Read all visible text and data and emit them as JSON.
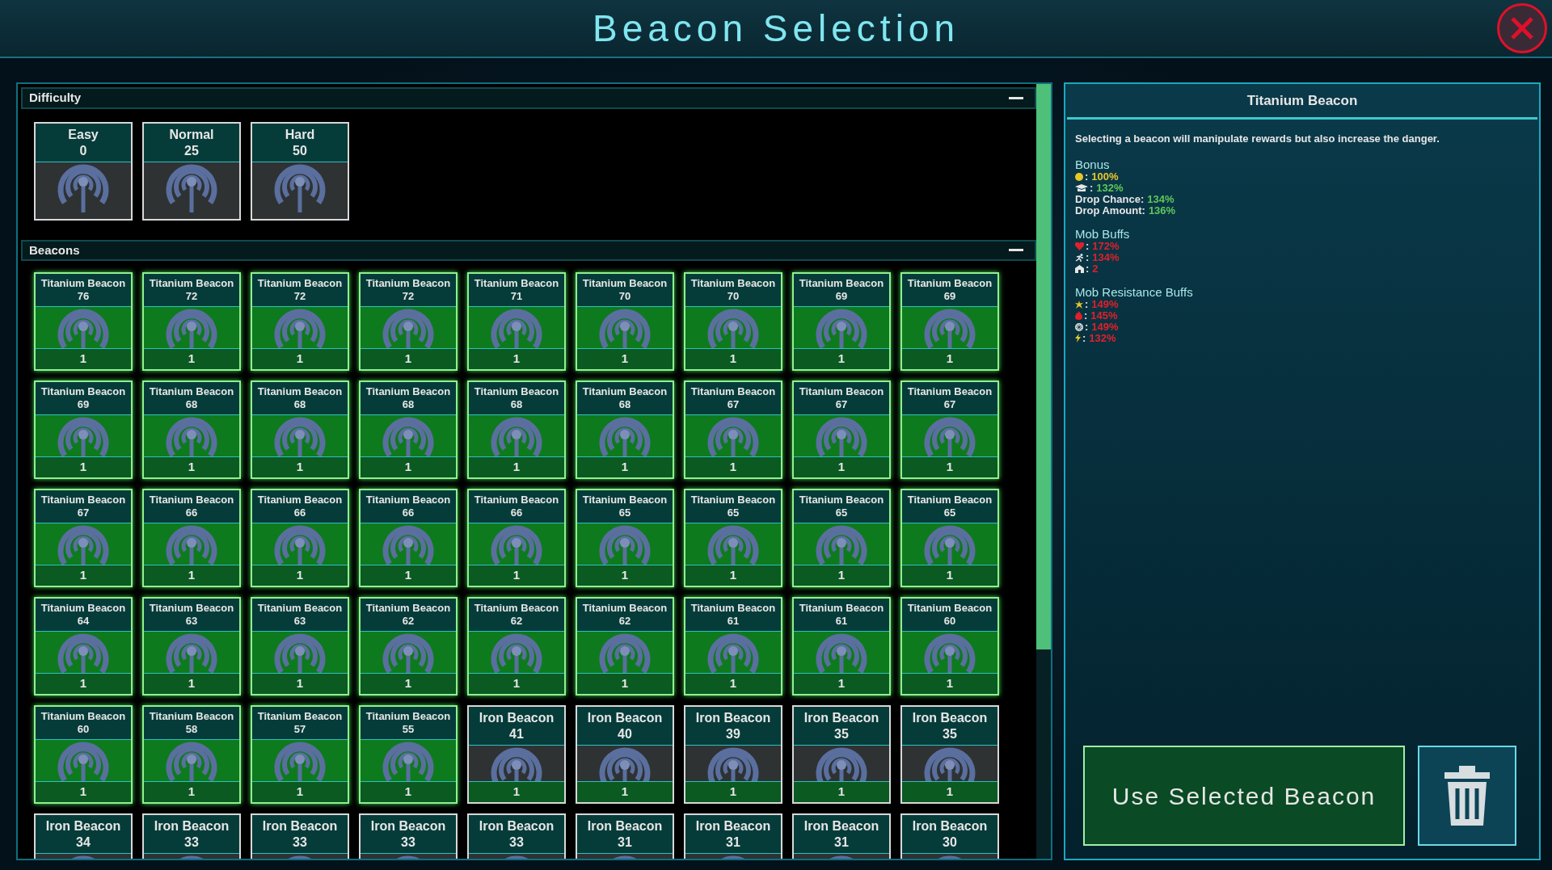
{
  "window": {
    "title": "Beacon Selection"
  },
  "difficulty": {
    "title": "Difficulty",
    "options": [
      {
        "name": "Easy",
        "number": "0"
      },
      {
        "name": "Normal",
        "number": "25"
      },
      {
        "name": "Hard",
        "number": "50"
      }
    ]
  },
  "beacons": {
    "title": "Beacons",
    "items": [
      {
        "name": "Titanium Beacon",
        "number": "76",
        "count": "1",
        "kind": "titanium"
      },
      {
        "name": "Titanium Beacon",
        "number": "72",
        "count": "1",
        "kind": "titanium"
      },
      {
        "name": "Titanium Beacon",
        "number": "72",
        "count": "1",
        "kind": "titanium"
      },
      {
        "name": "Titanium Beacon",
        "number": "72",
        "count": "1",
        "kind": "titanium"
      },
      {
        "name": "Titanium Beacon",
        "number": "71",
        "count": "1",
        "kind": "titanium"
      },
      {
        "name": "Titanium Beacon",
        "number": "70",
        "count": "1",
        "kind": "titanium"
      },
      {
        "name": "Titanium Beacon",
        "number": "70",
        "count": "1",
        "kind": "titanium"
      },
      {
        "name": "Titanium Beacon",
        "number": "69",
        "count": "1",
        "kind": "titanium"
      },
      {
        "name": "Titanium Beacon",
        "number": "69",
        "count": "1",
        "kind": "titanium"
      },
      {
        "name": "Titanium Beacon",
        "number": "69",
        "count": "1",
        "kind": "titanium"
      },
      {
        "name": "Titanium Beacon",
        "number": "68",
        "count": "1",
        "kind": "titanium"
      },
      {
        "name": "Titanium Beacon",
        "number": "68",
        "count": "1",
        "kind": "titanium"
      },
      {
        "name": "Titanium Beacon",
        "number": "68",
        "count": "1",
        "kind": "titanium"
      },
      {
        "name": "Titanium Beacon",
        "number": "68",
        "count": "1",
        "kind": "titanium"
      },
      {
        "name": "Titanium Beacon",
        "number": "68",
        "count": "1",
        "kind": "titanium"
      },
      {
        "name": "Titanium Beacon",
        "number": "67",
        "count": "1",
        "kind": "titanium"
      },
      {
        "name": "Titanium Beacon",
        "number": "67",
        "count": "1",
        "kind": "titanium"
      },
      {
        "name": "Titanium Beacon",
        "number": "67",
        "count": "1",
        "kind": "titanium"
      },
      {
        "name": "Titanium Beacon",
        "number": "67",
        "count": "1",
        "kind": "titanium"
      },
      {
        "name": "Titanium Beacon",
        "number": "66",
        "count": "1",
        "kind": "titanium"
      },
      {
        "name": "Titanium Beacon",
        "number": "66",
        "count": "1",
        "kind": "titanium"
      },
      {
        "name": "Titanium Beacon",
        "number": "66",
        "count": "1",
        "kind": "titanium"
      },
      {
        "name": "Titanium Beacon",
        "number": "66",
        "count": "1",
        "kind": "titanium"
      },
      {
        "name": "Titanium Beacon",
        "number": "65",
        "count": "1",
        "kind": "titanium"
      },
      {
        "name": "Titanium Beacon",
        "number": "65",
        "count": "1",
        "kind": "titanium"
      },
      {
        "name": "Titanium Beacon",
        "number": "65",
        "count": "1",
        "kind": "titanium"
      },
      {
        "name": "Titanium Beacon",
        "number": "65",
        "count": "1",
        "kind": "titanium"
      },
      {
        "name": "Titanium Beacon",
        "number": "64",
        "count": "1",
        "kind": "titanium"
      },
      {
        "name": "Titanium Beacon",
        "number": "63",
        "count": "1",
        "kind": "titanium"
      },
      {
        "name": "Titanium Beacon",
        "number": "63",
        "count": "1",
        "kind": "titanium"
      },
      {
        "name": "Titanium Beacon",
        "number": "62",
        "count": "1",
        "kind": "titanium"
      },
      {
        "name": "Titanium Beacon",
        "number": "62",
        "count": "1",
        "kind": "titanium"
      },
      {
        "name": "Titanium Beacon",
        "number": "62",
        "count": "1",
        "kind": "titanium"
      },
      {
        "name": "Titanium Beacon",
        "number": "61",
        "count": "1",
        "kind": "titanium"
      },
      {
        "name": "Titanium Beacon",
        "number": "61",
        "count": "1",
        "kind": "titanium"
      },
      {
        "name": "Titanium Beacon",
        "number": "60",
        "count": "1",
        "kind": "titanium"
      },
      {
        "name": "Titanium Beacon",
        "number": "60",
        "count": "1",
        "kind": "titanium"
      },
      {
        "name": "Titanium Beacon",
        "number": "58",
        "count": "1",
        "kind": "titanium"
      },
      {
        "name": "Titanium Beacon",
        "number": "57",
        "count": "1",
        "kind": "titanium"
      },
      {
        "name": "Titanium Beacon",
        "number": "55",
        "count": "1",
        "kind": "titanium"
      },
      {
        "name": "Iron Beacon",
        "number": "41",
        "count": "1",
        "kind": "iron"
      },
      {
        "name": "Iron Beacon",
        "number": "40",
        "count": "1",
        "kind": "iron"
      },
      {
        "name": "Iron Beacon",
        "number": "39",
        "count": "1",
        "kind": "iron"
      },
      {
        "name": "Iron Beacon",
        "number": "35",
        "count": "1",
        "kind": "iron"
      },
      {
        "name": "Iron Beacon",
        "number": "35",
        "count": "1",
        "kind": "iron"
      },
      {
        "name": "Iron Beacon",
        "number": "34",
        "kind": "iron"
      },
      {
        "name": "Iron Beacon",
        "number": "33",
        "kind": "iron"
      },
      {
        "name": "Iron Beacon",
        "number": "33",
        "kind": "iron"
      },
      {
        "name": "Iron Beacon",
        "number": "33",
        "kind": "iron"
      },
      {
        "name": "Iron Beacon",
        "number": "33",
        "kind": "iron"
      },
      {
        "name": "Iron Beacon",
        "number": "31",
        "kind": "iron"
      },
      {
        "name": "Iron Beacon",
        "number": "31",
        "kind": "iron"
      },
      {
        "name": "Iron Beacon",
        "number": "31",
        "kind": "iron"
      },
      {
        "name": "Iron Beacon",
        "number": "30",
        "kind": "iron"
      }
    ]
  },
  "details": {
    "title": "Titanium Beacon",
    "description": "Selecting a beacon will manipulate rewards but also increase the danger.",
    "sections": [
      {
        "title": "Bonus",
        "lines": [
          {
            "kind": "coin",
            "separator": ":",
            "value": "100%",
            "color": "#e8c62a"
          },
          {
            "kind": "xp",
            "separator": ":",
            "value": "132%",
            "color": "#5fc75a"
          },
          {
            "kind": "label",
            "label": "Drop Chance:",
            "value": "134%",
            "color": "#5fc75a"
          },
          {
            "kind": "label",
            "label": "Drop Amount:",
            "value": "136%",
            "color": "#5fc75a"
          }
        ]
      },
      {
        "title": "Mob Buffs",
        "lines": [
          {
            "kind": "health",
            "separator": ":",
            "value": "172%",
            "color": "#e0202a"
          },
          {
            "kind": "speed",
            "separator": ":",
            "value": "134%",
            "color": "#e0202a"
          },
          {
            "kind": "count",
            "separator": ":",
            "value": "2",
            "color": "#e0202a"
          }
        ]
      },
      {
        "title": "Mob Resistance Buffs",
        "lines": [
          {
            "kind": "shock",
            "separator": ":",
            "value": "149%",
            "color": "#e0202a"
          },
          {
            "kind": "fire",
            "separator": ":",
            "value": "145%",
            "color": "#e0202a"
          },
          {
            "kind": "frost",
            "separator": ":",
            "value": "149%",
            "color": "#e0202a"
          },
          {
            "kind": "lightning",
            "separator": ":",
            "value": "132%",
            "color": "#e0202a"
          }
        ]
      }
    ]
  },
  "actions": {
    "use_button": "Use Selected Beacon"
  }
}
